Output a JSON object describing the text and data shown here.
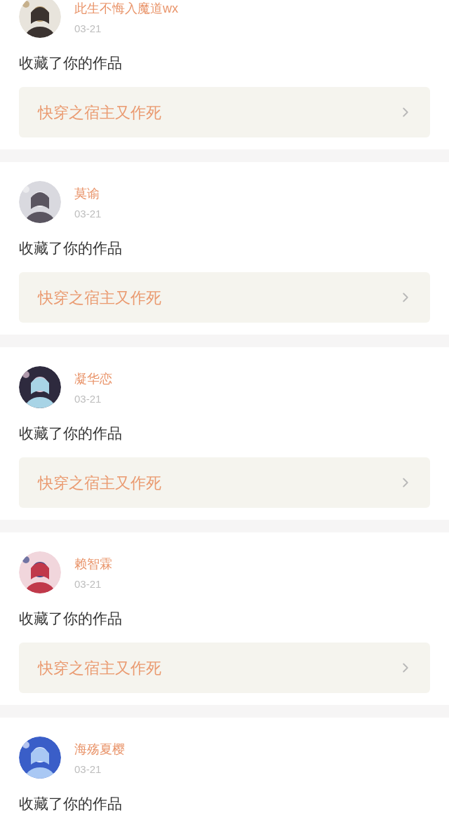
{
  "notifications": [
    {
      "name": "此生不悔入魔道wx",
      "date": "03-21",
      "action": "收藏了你的作品",
      "book": "快穿之宿主又作死"
    },
    {
      "name": "莫谕",
      "date": "03-21",
      "action": "收藏了你的作品",
      "book": "快穿之宿主又作死"
    },
    {
      "name": "凝华恋",
      "date": "03-21",
      "action": "收藏了你的作品",
      "book": "快穿之宿主又作死"
    },
    {
      "name": "赖智霖",
      "date": "03-21",
      "action": "收藏了你的作品",
      "book": "快穿之宿主又作死"
    },
    {
      "name": "海殇夏樱",
      "date": "03-21",
      "action": "收藏了你的作品"
    }
  ]
}
